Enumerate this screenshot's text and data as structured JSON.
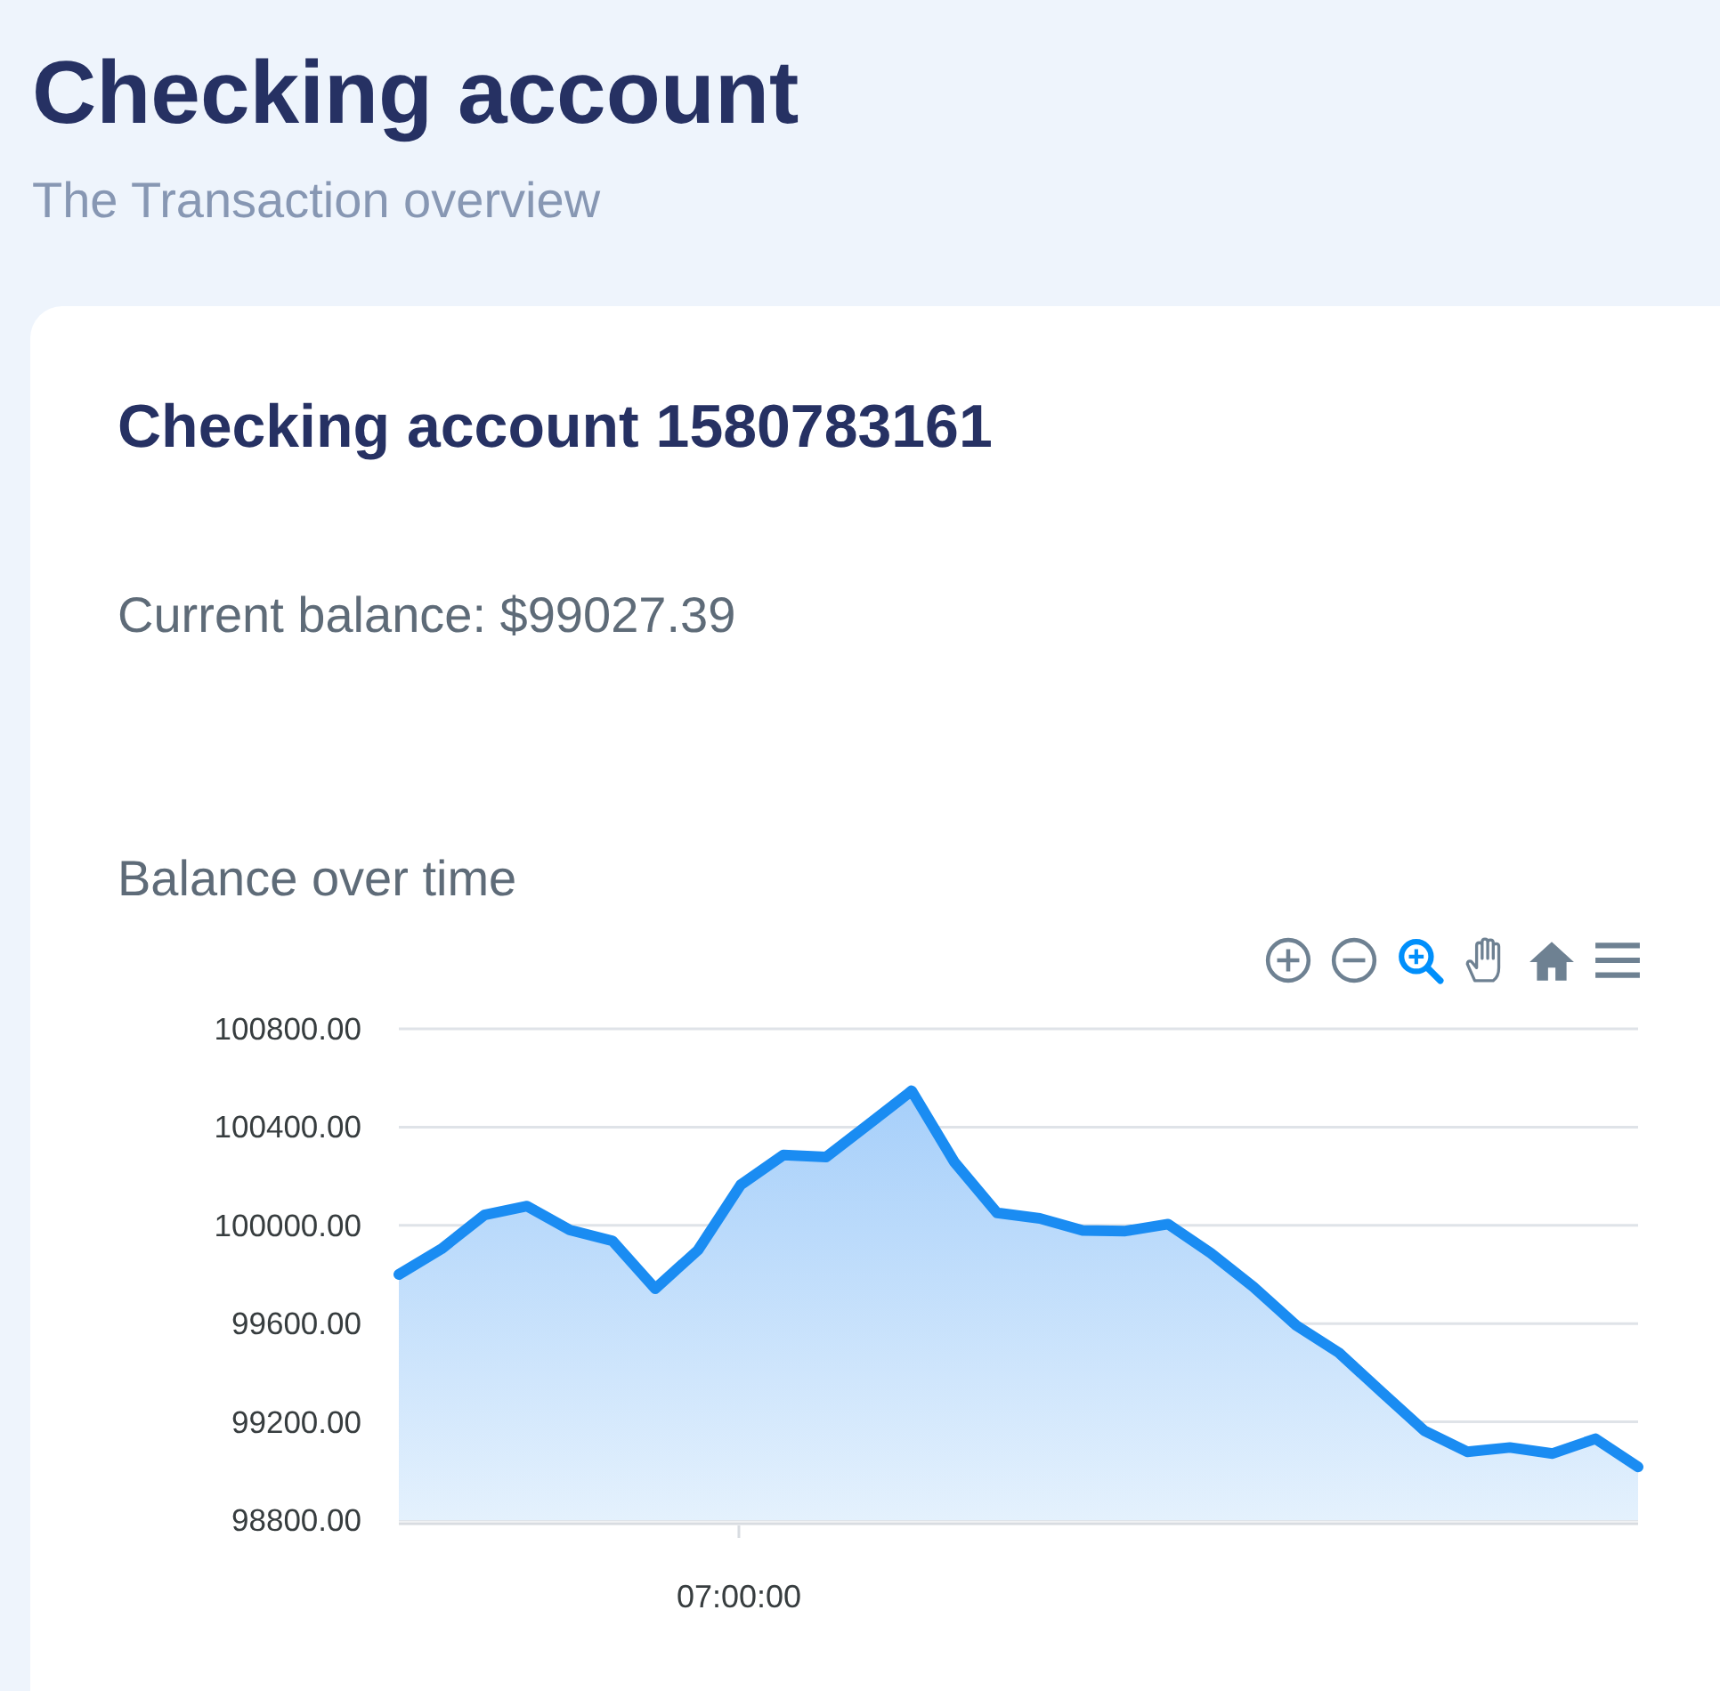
{
  "page": {
    "title": "Checking account",
    "subtitle": "The Transaction overview"
  },
  "account": {
    "title": "Checking account 1580783161",
    "balance": "Current balance: $99027.39"
  },
  "toolbar": [
    {
      "kind": "zoom-in",
      "selected": false
    },
    {
      "kind": "zoom-out",
      "selected": false
    },
    {
      "kind": "zoom",
      "selected": true
    },
    {
      "kind": "pan",
      "selected": false
    },
    {
      "kind": "home",
      "selected": false
    },
    {
      "kind": "menu",
      "selected": false
    }
  ],
  "chart_data": {
    "type": "area",
    "title": "Balance over time",
    "values": [
      99800,
      99904,
      100042,
      100078,
      99981,
      99937,
      99742,
      99899,
      100165,
      100286,
      100278,
      100412,
      100548,
      100258,
      100051,
      100028,
      99979,
      99977,
      100005,
      99887,
      99749,
      99593,
      99481,
      99321,
      99164,
      99078,
      99096,
      99071,
      99131,
      99017
    ],
    "ylim": [
      98800,
      100800
    ],
    "grid": true,
    "yticks": [
      {
        "value": 100800,
        "label": "100800.00"
      },
      {
        "value": 100400,
        "label": "100400.00"
      },
      {
        "value": 100000,
        "label": "100000.00"
      },
      {
        "value": 99600,
        "label": "99600.00"
      },
      {
        "value": 99200,
        "label": "99200.00"
      },
      {
        "value": 98800,
        "label": "98800.00"
      }
    ],
    "annotations": [
      "07:00:00"
    ]
  }
}
